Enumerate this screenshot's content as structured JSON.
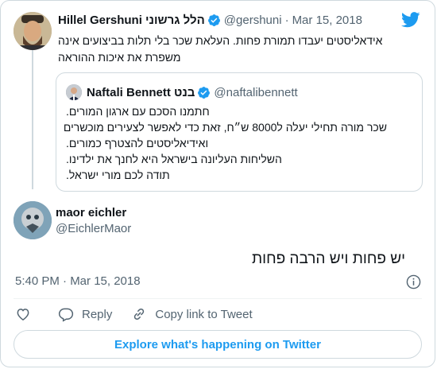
{
  "parent_tweet": {
    "display_name": "Hillel Gershuni הלל גרשוני",
    "handle": "@gershuni",
    "separator": "·",
    "date": "Mar 15, 2018",
    "text": "אידאליסטים יעבדו תמורת פחות. העלאת שכר בלי תלות בביצועים אינה משפרת את איכות ההוראה"
  },
  "quoted_tweet": {
    "display_name": "Naftali Bennett בנט",
    "handle": "@naftalibennett",
    "lines": [
      "חתמנו הסכם עם ארגון המורים.",
      "שכר מורה תחילי יעלה  ל8000 ש״ח, זאת כדי לאפשר לצעירים מוכשרים",
      "ואידיאליסטים להצטרף כמורים.",
      "השליחות העליונה בישראל היא לחנך את ילדינו.",
      "תודה לכם מורי ישראל."
    ]
  },
  "reply_tweet": {
    "display_name": "maor eichler",
    "handle": "@EichlerMaor",
    "text": "יש פחות ויש הרבה פחות",
    "timestamp": "5:40 PM · Mar 15, 2018"
  },
  "actions": {
    "reply_label": "Reply",
    "copy_link_label": "Copy link to Tweet"
  },
  "explore_label": "Explore what's happening on Twitter",
  "colors": {
    "accent": "#1d9bf0",
    "text": "#0f1419",
    "muted": "#536471",
    "border": "#cfd9de"
  },
  "icons": [
    "twitter-bird-icon",
    "verified-badge-icon",
    "info-icon",
    "heart-icon",
    "reply-icon",
    "link-icon"
  ]
}
